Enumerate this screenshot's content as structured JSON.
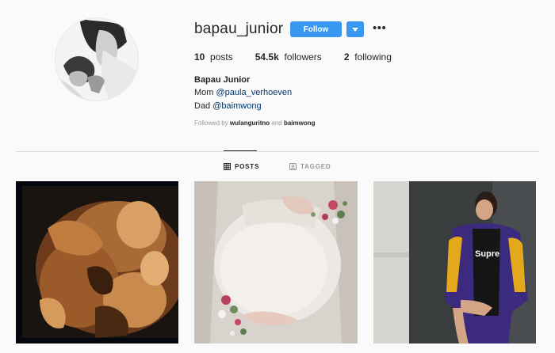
{
  "profile": {
    "username": "bapau_junior",
    "follow_label": "Follow",
    "posts_count": "10",
    "posts_label": "posts",
    "followers_count": "54.5k",
    "followers_label": "followers",
    "following_count": "2",
    "following_label": "following",
    "full_name": "Bapau Junior",
    "bio_line1_prefix": "Mom ",
    "bio_line1_mention": "@paula_verhoeven",
    "bio_line2_prefix": "Dad ",
    "bio_line2_mention": "@baimwong",
    "followed_by_prefix": "Followed by ",
    "followed_by_user1": "wulanguritno",
    "followed_by_and": " and ",
    "followed_by_user2": "baimwong"
  },
  "tabs": [
    {
      "label": "POSTS",
      "icon": "grid-icon",
      "active": true
    },
    {
      "label": "TAGGED",
      "icon": "tagged-icon",
      "active": false
    }
  ],
  "colors": {
    "accent": "#3897f0",
    "mention": "#003569",
    "muted": "#999999"
  },
  "posts": [
    {
      "description": "ultrasound"
    },
    {
      "description": "maternity"
    },
    {
      "description": "jacket"
    }
  ]
}
